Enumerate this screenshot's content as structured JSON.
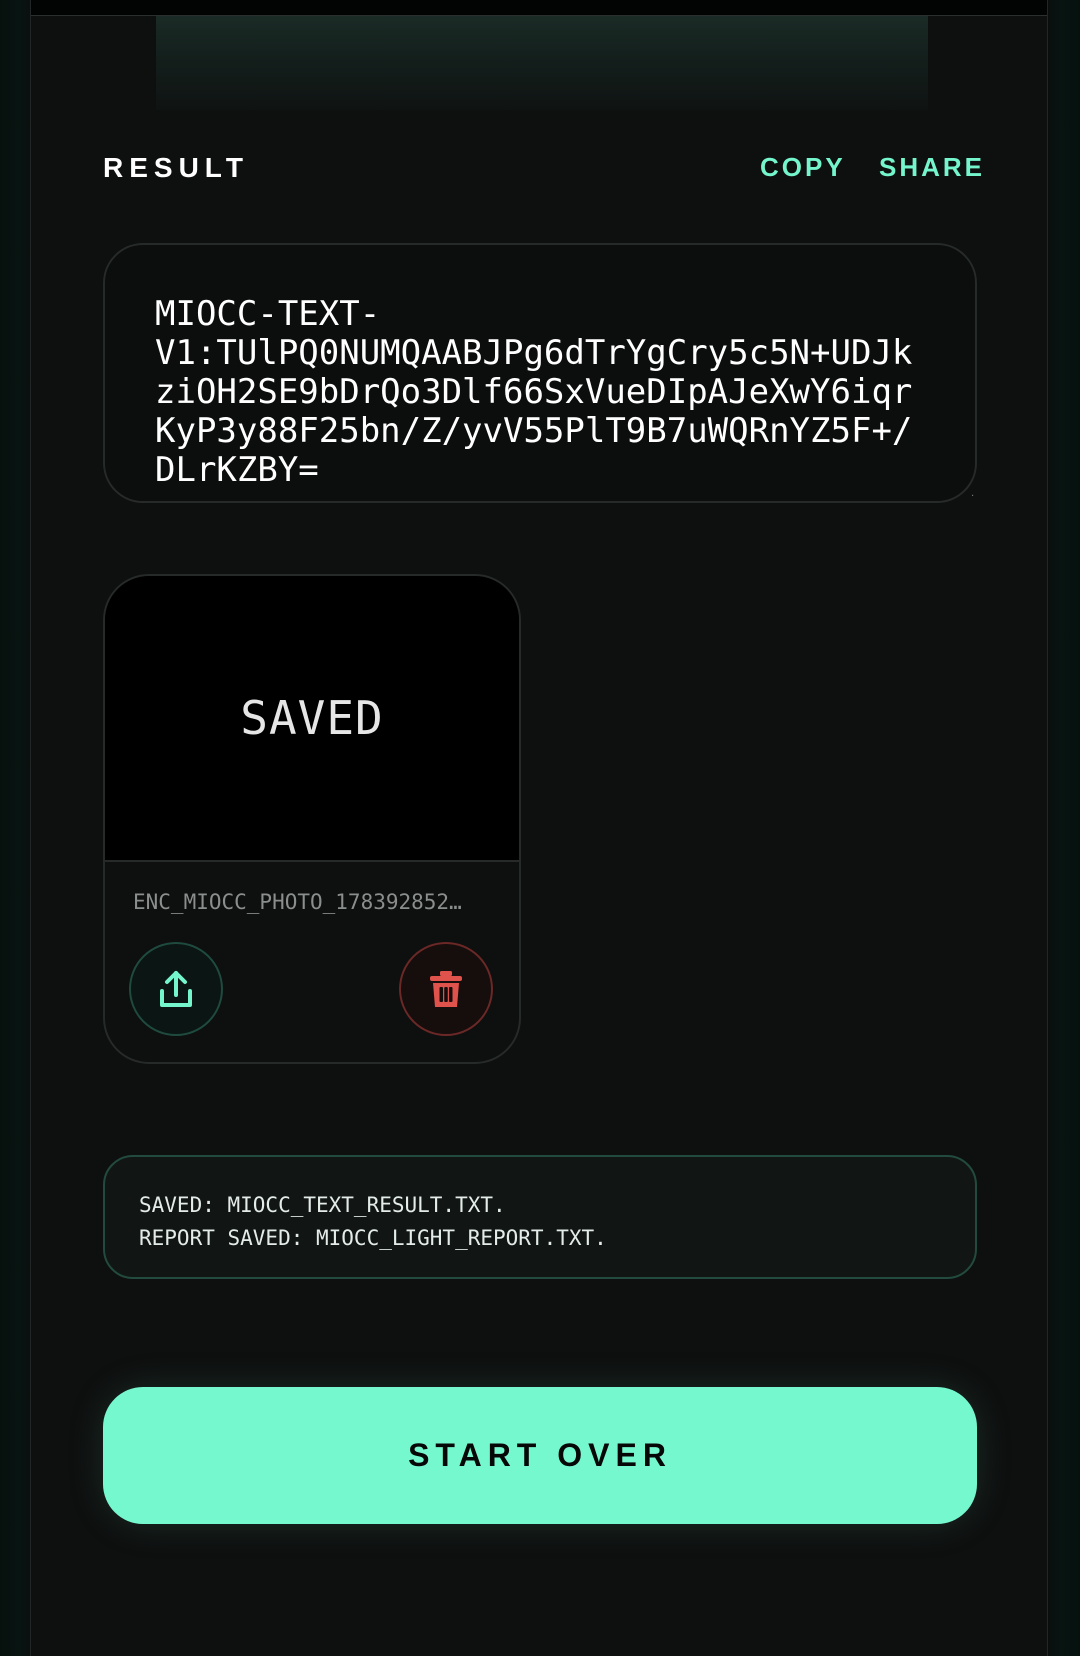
{
  "header": {
    "title": "RESULT",
    "copy_label": "COPY",
    "share_label": "SHARE"
  },
  "result": {
    "text": "MIOCC-TEXT-\nV1:TUlPQ0NUMQAABJPg6dTrYgCry5c5N+UDJkziOH2SE9bDrQo3Dlf66SxVueDIpAJeXwY6iqrKyP3y88F25bn/Z/yvV55PlT9B7uWQRnYZ5F+/DLrKZBY="
  },
  "photo_card": {
    "preview_text": "SAVED",
    "file_name": "ENC_MIOCC_PHOTO_178392852…",
    "share_icon": "share-upload-icon",
    "delete_icon": "trash-icon"
  },
  "status": {
    "lines": [
      "SAVED: MIOCC_TEXT_RESULT.TXT.",
      "REPORT SAVED: MIOCC_LIGHT_REPORT.TXT."
    ]
  },
  "actions": {
    "start_over_label": "START OVER"
  },
  "colors": {
    "accent": "#76f8cf",
    "danger": "#e0524c",
    "background": "#0e0f0f"
  }
}
